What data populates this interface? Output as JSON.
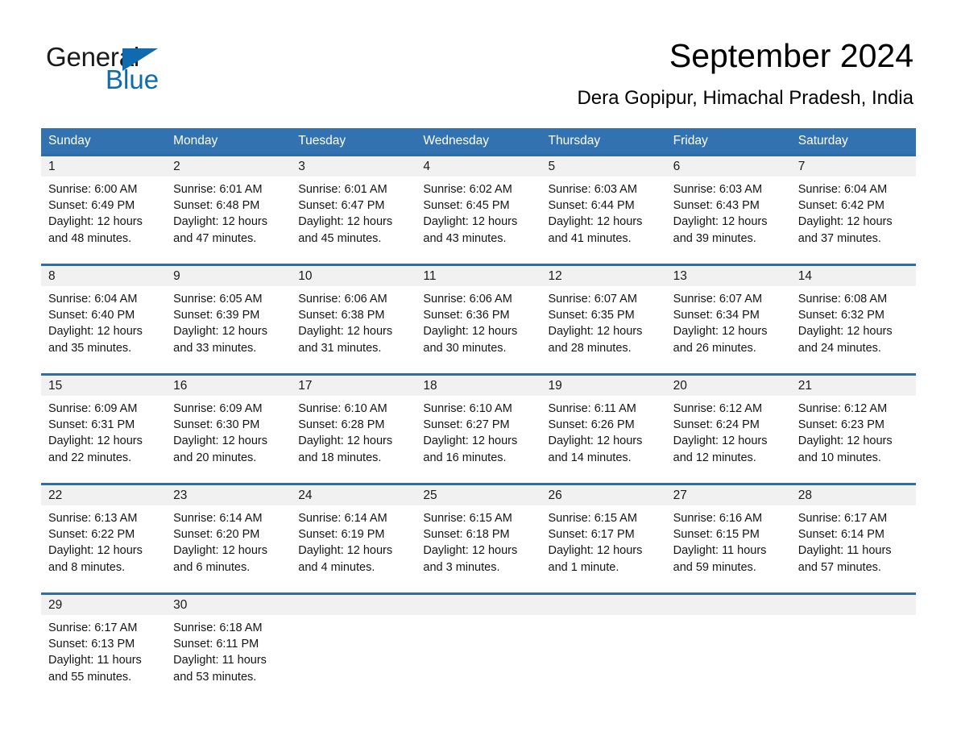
{
  "brand": {
    "name_part1": "General",
    "name_part2": "Blue",
    "accent_color": "#0f6ab0",
    "triangle_icon": "triangle-icon"
  },
  "header": {
    "title": "September 2024",
    "subtitle": "Dera Gopipur, Himachal Pradesh, India"
  },
  "colors": {
    "header_blue": "#3272b0",
    "rule_blue": "#2e6da8",
    "daynum_bg": "#f1f1f1",
    "text": "#141414"
  },
  "calendar": {
    "weekday_headers": [
      "Sunday",
      "Monday",
      "Tuesday",
      "Wednesday",
      "Thursday",
      "Friday",
      "Saturday"
    ],
    "weeks": [
      {
        "days": [
          {
            "num": "1",
            "sunrise": "Sunrise: 6:00 AM",
            "sunset": "Sunset: 6:49 PM",
            "daylight1": "Daylight: 12 hours",
            "daylight2": "and 48 minutes."
          },
          {
            "num": "2",
            "sunrise": "Sunrise: 6:01 AM",
            "sunset": "Sunset: 6:48 PM",
            "daylight1": "Daylight: 12 hours",
            "daylight2": "and 47 minutes."
          },
          {
            "num": "3",
            "sunrise": "Sunrise: 6:01 AM",
            "sunset": "Sunset: 6:47 PM",
            "daylight1": "Daylight: 12 hours",
            "daylight2": "and 45 minutes."
          },
          {
            "num": "4",
            "sunrise": "Sunrise: 6:02 AM",
            "sunset": "Sunset: 6:45 PM",
            "daylight1": "Daylight: 12 hours",
            "daylight2": "and 43 minutes."
          },
          {
            "num": "5",
            "sunrise": "Sunrise: 6:03 AM",
            "sunset": "Sunset: 6:44 PM",
            "daylight1": "Daylight: 12 hours",
            "daylight2": "and 41 minutes."
          },
          {
            "num": "6",
            "sunrise": "Sunrise: 6:03 AM",
            "sunset": "Sunset: 6:43 PM",
            "daylight1": "Daylight: 12 hours",
            "daylight2": "and 39 minutes."
          },
          {
            "num": "7",
            "sunrise": "Sunrise: 6:04 AM",
            "sunset": "Sunset: 6:42 PM",
            "daylight1": "Daylight: 12 hours",
            "daylight2": "and 37 minutes."
          }
        ]
      },
      {
        "days": [
          {
            "num": "8",
            "sunrise": "Sunrise: 6:04 AM",
            "sunset": "Sunset: 6:40 PM",
            "daylight1": "Daylight: 12 hours",
            "daylight2": "and 35 minutes."
          },
          {
            "num": "9",
            "sunrise": "Sunrise: 6:05 AM",
            "sunset": "Sunset: 6:39 PM",
            "daylight1": "Daylight: 12 hours",
            "daylight2": "and 33 minutes."
          },
          {
            "num": "10",
            "sunrise": "Sunrise: 6:06 AM",
            "sunset": "Sunset: 6:38 PM",
            "daylight1": "Daylight: 12 hours",
            "daylight2": "and 31 minutes."
          },
          {
            "num": "11",
            "sunrise": "Sunrise: 6:06 AM",
            "sunset": "Sunset: 6:36 PM",
            "daylight1": "Daylight: 12 hours",
            "daylight2": "and 30 minutes."
          },
          {
            "num": "12",
            "sunrise": "Sunrise: 6:07 AM",
            "sunset": "Sunset: 6:35 PM",
            "daylight1": "Daylight: 12 hours",
            "daylight2": "and 28 minutes."
          },
          {
            "num": "13",
            "sunrise": "Sunrise: 6:07 AM",
            "sunset": "Sunset: 6:34 PM",
            "daylight1": "Daylight: 12 hours",
            "daylight2": "and 26 minutes."
          },
          {
            "num": "14",
            "sunrise": "Sunrise: 6:08 AM",
            "sunset": "Sunset: 6:32 PM",
            "daylight1": "Daylight: 12 hours",
            "daylight2": "and 24 minutes."
          }
        ]
      },
      {
        "days": [
          {
            "num": "15",
            "sunrise": "Sunrise: 6:09 AM",
            "sunset": "Sunset: 6:31 PM",
            "daylight1": "Daylight: 12 hours",
            "daylight2": "and 22 minutes."
          },
          {
            "num": "16",
            "sunrise": "Sunrise: 6:09 AM",
            "sunset": "Sunset: 6:30 PM",
            "daylight1": "Daylight: 12 hours",
            "daylight2": "and 20 minutes."
          },
          {
            "num": "17",
            "sunrise": "Sunrise: 6:10 AM",
            "sunset": "Sunset: 6:28 PM",
            "daylight1": "Daylight: 12 hours",
            "daylight2": "and 18 minutes."
          },
          {
            "num": "18",
            "sunrise": "Sunrise: 6:10 AM",
            "sunset": "Sunset: 6:27 PM",
            "daylight1": "Daylight: 12 hours",
            "daylight2": "and 16 minutes."
          },
          {
            "num": "19",
            "sunrise": "Sunrise: 6:11 AM",
            "sunset": "Sunset: 6:26 PM",
            "daylight1": "Daylight: 12 hours",
            "daylight2": "and 14 minutes."
          },
          {
            "num": "20",
            "sunrise": "Sunrise: 6:12 AM",
            "sunset": "Sunset: 6:24 PM",
            "daylight1": "Daylight: 12 hours",
            "daylight2": "and 12 minutes."
          },
          {
            "num": "21",
            "sunrise": "Sunrise: 6:12 AM",
            "sunset": "Sunset: 6:23 PM",
            "daylight1": "Daylight: 12 hours",
            "daylight2": "and 10 minutes."
          }
        ]
      },
      {
        "days": [
          {
            "num": "22",
            "sunrise": "Sunrise: 6:13 AM",
            "sunset": "Sunset: 6:22 PM",
            "daylight1": "Daylight: 12 hours",
            "daylight2": "and 8 minutes."
          },
          {
            "num": "23",
            "sunrise": "Sunrise: 6:14 AM",
            "sunset": "Sunset: 6:20 PM",
            "daylight1": "Daylight: 12 hours",
            "daylight2": "and 6 minutes."
          },
          {
            "num": "24",
            "sunrise": "Sunrise: 6:14 AM",
            "sunset": "Sunset: 6:19 PM",
            "daylight1": "Daylight: 12 hours",
            "daylight2": "and 4 minutes."
          },
          {
            "num": "25",
            "sunrise": "Sunrise: 6:15 AM",
            "sunset": "Sunset: 6:18 PM",
            "daylight1": "Daylight: 12 hours",
            "daylight2": "and 3 minutes."
          },
          {
            "num": "26",
            "sunrise": "Sunrise: 6:15 AM",
            "sunset": "Sunset: 6:17 PM",
            "daylight1": "Daylight: 12 hours",
            "daylight2": "and 1 minute."
          },
          {
            "num": "27",
            "sunrise": "Sunrise: 6:16 AM",
            "sunset": "Sunset: 6:15 PM",
            "daylight1": "Daylight: 11 hours",
            "daylight2": "and 59 minutes."
          },
          {
            "num": "28",
            "sunrise": "Sunrise: 6:17 AM",
            "sunset": "Sunset: 6:14 PM",
            "daylight1": "Daylight: 11 hours",
            "daylight2": "and 57 minutes."
          }
        ]
      },
      {
        "days": [
          {
            "num": "29",
            "sunrise": "Sunrise: 6:17 AM",
            "sunset": "Sunset: 6:13 PM",
            "daylight1": "Daylight: 11 hours",
            "daylight2": "and 55 minutes."
          },
          {
            "num": "30",
            "sunrise": "Sunrise: 6:18 AM",
            "sunset": "Sunset: 6:11 PM",
            "daylight1": "Daylight: 11 hours",
            "daylight2": "and 53 minutes."
          },
          {
            "num": "",
            "sunrise": "",
            "sunset": "",
            "daylight1": "",
            "daylight2": ""
          },
          {
            "num": "",
            "sunrise": "",
            "sunset": "",
            "daylight1": "",
            "daylight2": ""
          },
          {
            "num": "",
            "sunrise": "",
            "sunset": "",
            "daylight1": "",
            "daylight2": ""
          },
          {
            "num": "",
            "sunrise": "",
            "sunset": "",
            "daylight1": "",
            "daylight2": ""
          },
          {
            "num": "",
            "sunrise": "",
            "sunset": "",
            "daylight1": "",
            "daylight2": ""
          }
        ]
      }
    ]
  }
}
